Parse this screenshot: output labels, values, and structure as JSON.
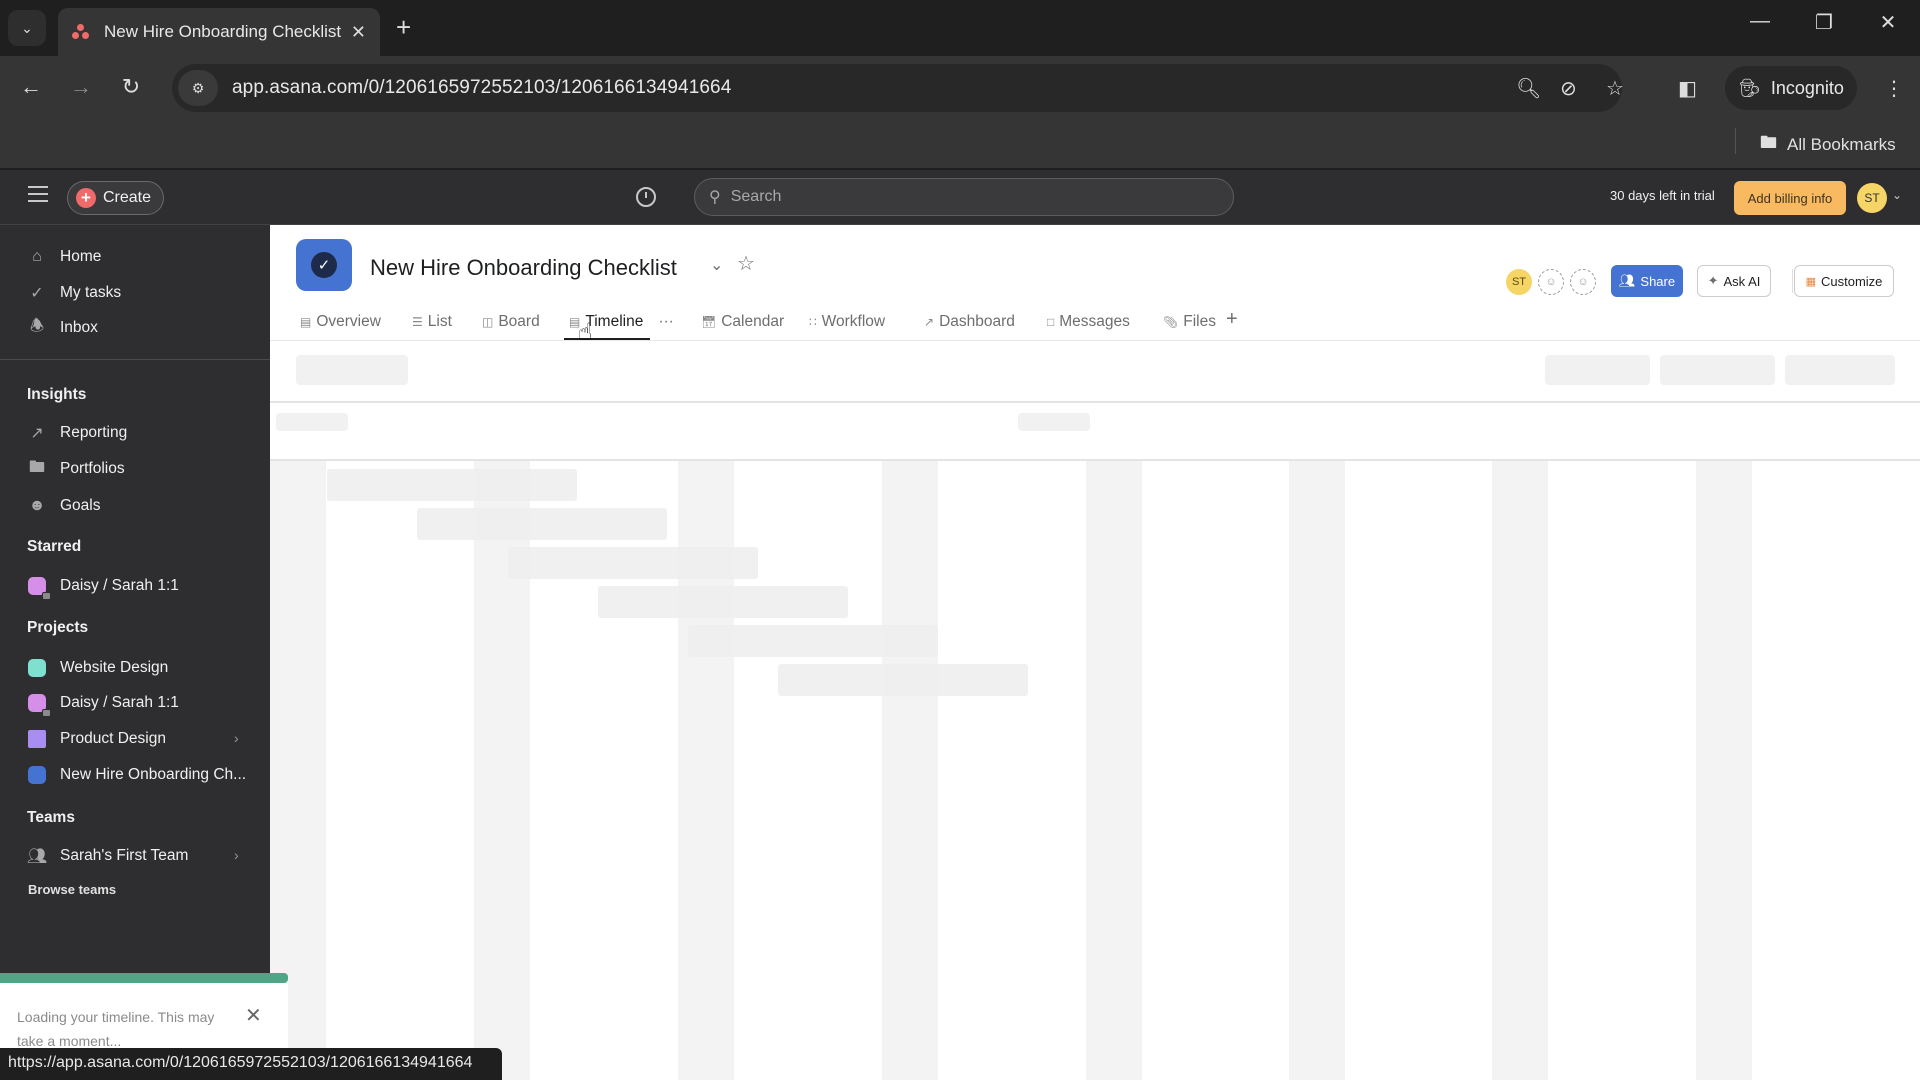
{
  "browser": {
    "tab_title": "New Hire Onboarding Checklist",
    "url": "app.asana.com/0/1206165972552103/1206166134941664",
    "incognito_label": "Incognito",
    "bookmarks_label": "All Bookmarks",
    "status_url": "https://app.asana.com/0/1206165972552103/1206166134941664",
    "icons": [
      "tab-search-icon",
      "back-icon",
      "forward-icon",
      "reload-icon",
      "site-info-icon",
      "zoom-icon",
      "eye-off-icon",
      "star-icon",
      "side-panel-icon",
      "incognito-icon",
      "kebab-menu-icon",
      "folder-icon",
      "minimize-icon",
      "restore-icon",
      "close-icon"
    ]
  },
  "topbar": {
    "create_label": "Create",
    "search_placeholder": "Search",
    "trial_text": "30 days left in trial",
    "billing_label": "Add billing info",
    "user_initials": "ST"
  },
  "sidebar": {
    "nav": [
      {
        "label": "Home",
        "icon": "home-icon"
      },
      {
        "label": "My tasks",
        "icon": "check-circle-icon"
      },
      {
        "label": "Inbox",
        "icon": "bell-icon"
      }
    ],
    "insights_heading": "Insights",
    "insights": [
      {
        "label": "Reporting",
        "icon": "chart-line-icon"
      },
      {
        "label": "Portfolios",
        "icon": "folder-icon"
      },
      {
        "label": "Goals",
        "icon": "person-icon"
      }
    ],
    "starred_heading": "Starred",
    "starred": [
      {
        "label": "Daisy / Sarah 1:1",
        "color": "#d68fe8",
        "locked": true
      }
    ],
    "projects_heading": "Projects",
    "projects": [
      {
        "label": "Website Design",
        "color": "#7ee0cf",
        "locked": false
      },
      {
        "label": "Daisy / Sarah 1:1",
        "color": "#d68fe8",
        "locked": true
      },
      {
        "label": "Product Design",
        "color": "#a88ef2",
        "type": "folder"
      },
      {
        "label": "New Hire Onboarding Ch...",
        "color": "#4573d2",
        "locked": false
      }
    ],
    "teams_heading": "Teams",
    "teams": [
      {
        "label": "Sarah's First Team",
        "icon": "team-icon"
      }
    ],
    "browse_teams": "Browse teams"
  },
  "toast": {
    "message": "Loading your timeline. This may take a moment...",
    "progress_percent": 100
  },
  "project": {
    "title": "New Hire Onboarding Checklist",
    "color": "#4573d2",
    "tabs": [
      {
        "label": "Overview",
        "active": false
      },
      {
        "label": "List",
        "active": false
      },
      {
        "label": "Board",
        "active": false
      },
      {
        "label": "Timeline",
        "active": true
      },
      {
        "label": "Calendar",
        "active": false
      },
      {
        "label": "Workflow",
        "active": false
      },
      {
        "label": "Dashboard",
        "active": false
      },
      {
        "label": "Messages",
        "active": false
      },
      {
        "label": "Files",
        "active": false
      }
    ],
    "tab_more": "···",
    "add_tab": "+",
    "members": [
      "ST"
    ],
    "share_label": "Share",
    "ask_ai_label": "Ask AI",
    "customize_label": "Customize"
  },
  "colors": {
    "accent_blue": "#4573d2",
    "create_red": "#f06a6a",
    "billing_orange": "#f8b960",
    "progress_green": "#4fa586"
  }
}
